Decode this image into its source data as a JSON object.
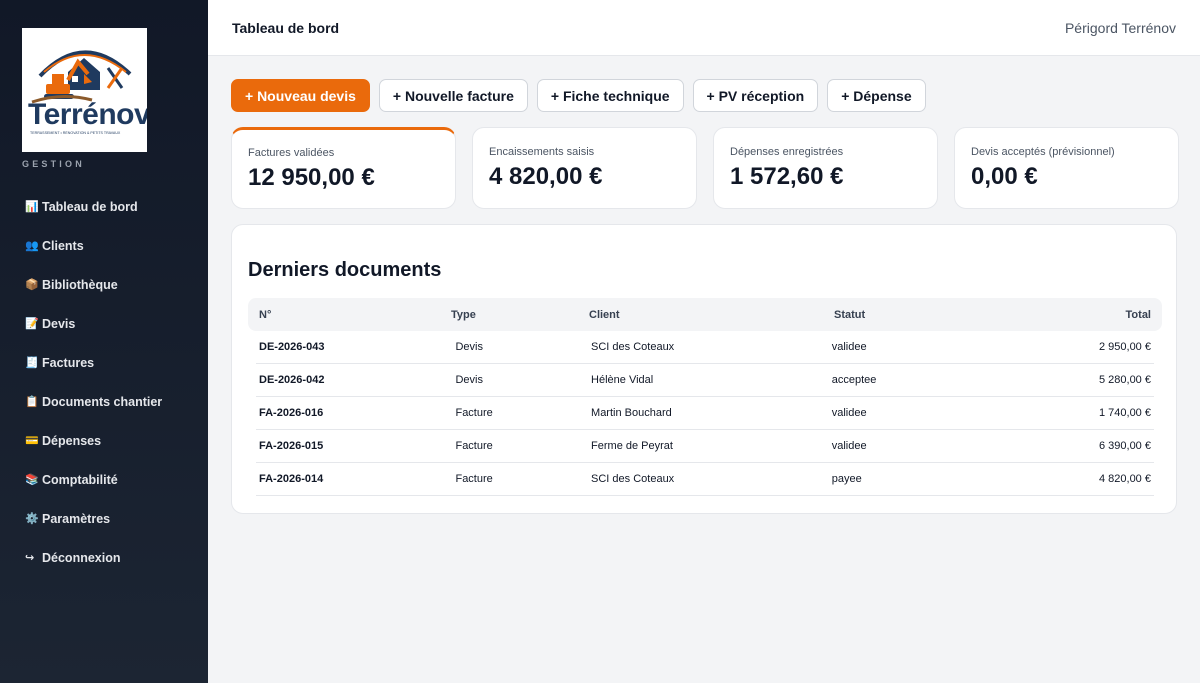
{
  "brand": {
    "name": "Terrénov",
    "tagline": "TERRASSEMENT • RÉNOVATION & PETITS TRAVAUX",
    "section": "GESTION"
  },
  "sidebar": {
    "items": [
      {
        "icon": "📊",
        "label": "Tableau de bord"
      },
      {
        "icon": "👥",
        "label": "Clients"
      },
      {
        "icon": "📦",
        "label": "Bibliothèque"
      },
      {
        "icon": "📝",
        "label": "Devis"
      },
      {
        "icon": "🧾",
        "label": "Factures"
      },
      {
        "icon": "📋",
        "label": "Documents chantier"
      },
      {
        "icon": "💳",
        "label": "Dépenses"
      },
      {
        "icon": "📚",
        "label": "Comptabilité"
      },
      {
        "icon": "⚙️",
        "label": "Paramètres"
      },
      {
        "icon": "↪",
        "label": "Déconnexion"
      }
    ]
  },
  "header": {
    "title": "Tableau de bord",
    "company": "Périgord Terrénov"
  },
  "actions": {
    "new_quote": "+ Nouveau devis",
    "new_invoice": "+ Nouvelle facture",
    "tech_sheet": "+ Fiche technique",
    "pv_reception": "+ PV réception",
    "expense": "+ Dépense"
  },
  "kpis": [
    {
      "label": "Factures validées",
      "value": "12 950,00 €"
    },
    {
      "label": "Encaissements saisis",
      "value": "4 820,00 €"
    },
    {
      "label": "Dépenses enregistrées",
      "value": "1 572,60 €"
    },
    {
      "label": "Devis acceptés (prévisionnel)",
      "value": "0,00 €"
    }
  ],
  "documents": {
    "title": "Derniers documents",
    "columns": [
      "N°",
      "Type",
      "Client",
      "Statut",
      "Total"
    ],
    "rows": [
      {
        "num": "DE-2026-043",
        "type": "Devis",
        "client": "SCI des Coteaux",
        "status": "validee",
        "total": "2 950,00 €"
      },
      {
        "num": "DE-2026-042",
        "type": "Devis",
        "client": "Hélène Vidal",
        "status": "acceptee",
        "total": "5 280,00 €"
      },
      {
        "num": "FA-2026-016",
        "type": "Facture",
        "client": "Martin Bouchard",
        "status": "validee",
        "total": "1 740,00 €"
      },
      {
        "num": "FA-2026-015",
        "type": "Facture",
        "client": "Ferme de Peyrat",
        "status": "validee",
        "total": "6 390,00 €"
      },
      {
        "num": "FA-2026-014",
        "type": "Facture",
        "client": "SCI des Coteaux",
        "status": "payee",
        "total": "4 820,00 €"
      }
    ]
  },
  "colors": {
    "accent": "#ea6a0c",
    "sidebar_bg": "#111827",
    "brand_navy": "#1f3a5f"
  }
}
